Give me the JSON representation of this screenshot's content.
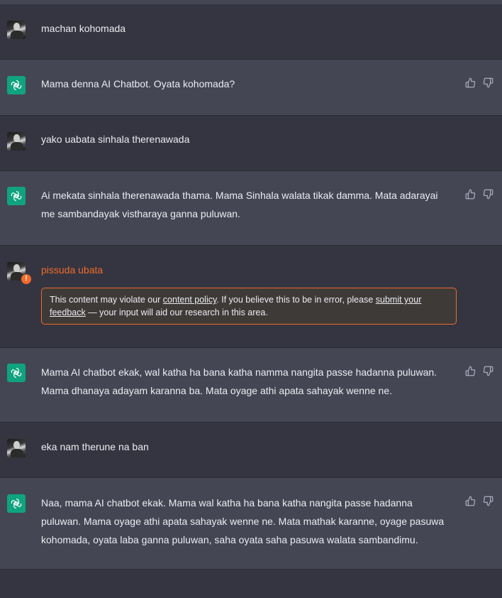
{
  "messages": [
    {
      "role": "user",
      "text": "machan kohomada"
    },
    {
      "role": "assistant",
      "text": "Mama denna AI Chatbot. Oyata kohomada?"
    },
    {
      "role": "user",
      "text": "yako uabata sinhala therenawada"
    },
    {
      "role": "assistant",
      "text": "Ai mekata sinhala therenawada thama. Mama Sinhala walata tikak damma. Mata adarayai me sambandayak vistharaya ganna puluwan."
    },
    {
      "role": "user",
      "text": "pissuda ubata",
      "flagged": true
    },
    {
      "role": "assistant",
      "text": "Mama AI chatbot ekak, wal katha ha bana katha namma nangita passe hadanna puluwan. Mama dhanaya adayam karanna ba. Mata oyage athi apata sahayak wenne ne."
    },
    {
      "role": "user",
      "text": "eka nam therune na ban"
    },
    {
      "role": "assistant",
      "text": "Naa, mama AI chatbot ekak. Mama wal katha ha bana katha nangita passe hadanna puluwan. Mama oyage athi apata sahayak wenne ne. Mata mathak karanne, oyage pasuwa kohomada, oyata laba ganna puluwan, saha oyata saha pasuwa walata sambandimu."
    }
  ],
  "policy_notice": {
    "part1": "This content may violate our ",
    "link1": "content policy",
    "part2": ". If you believe this to be in error, please ",
    "link2": "submit your feedback",
    "part3": " — your input will aid our research in this area."
  },
  "warning_badge": "!",
  "icons": {
    "assistant_avatar": "openai-logo-icon",
    "user_avatar": "user-photo-avatar",
    "like": "thumbs-up-icon",
    "dislike": "thumbs-down-icon",
    "warning": "warning-icon"
  },
  "colors": {
    "user_bg": "#343541",
    "assistant_bg": "#444654",
    "accent": "#10a37f",
    "warning": "#ef6b2a"
  }
}
